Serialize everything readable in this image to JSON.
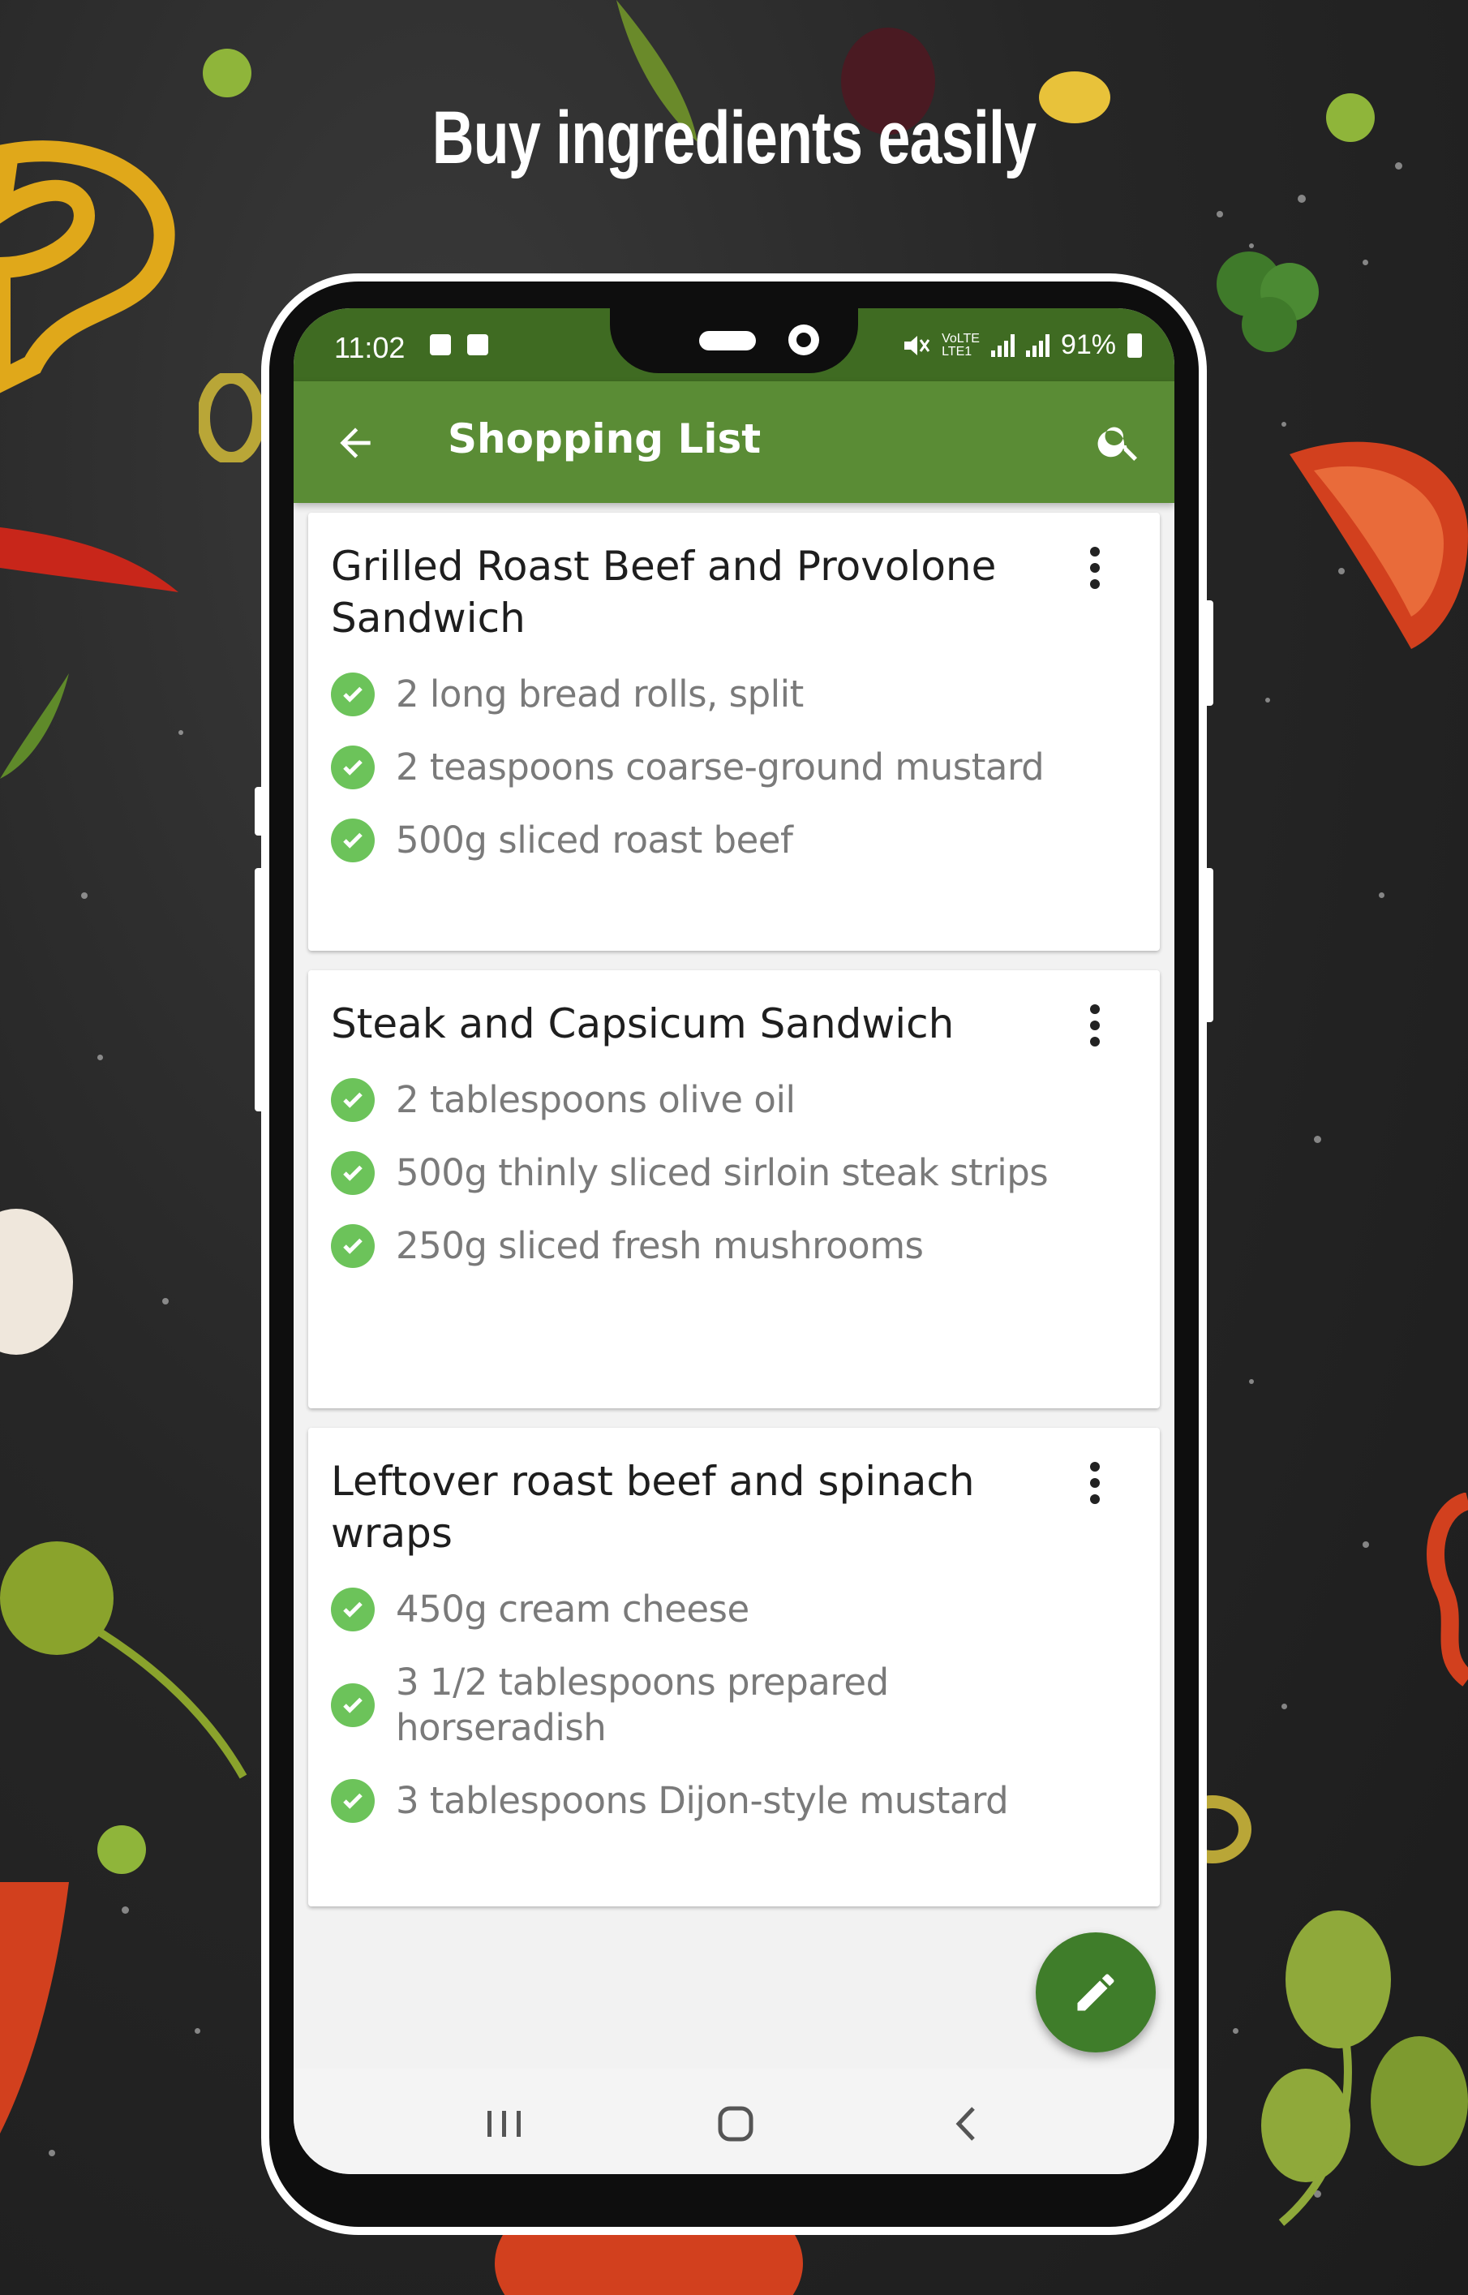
{
  "promo": {
    "headline": "Buy ingredients easily"
  },
  "status_bar": {
    "time": "11:02",
    "battery": "91%",
    "icons": [
      "check-notification-icon",
      "mail-notification-icon",
      "mute-icon",
      "volte-icon",
      "signal-icon",
      "battery-icon"
    ]
  },
  "app_bar": {
    "title": "Shopping List",
    "back_icon": "arrow-back-icon",
    "search_icon": "search-icon"
  },
  "recipes": [
    {
      "title": "Grilled Roast Beef and Provolone Sandwich",
      "ingredients": [
        "2 long bread rolls, split",
        "2 teaspoons coarse-ground mustard",
        "500g sliced roast beef"
      ]
    },
    {
      "title": "Steak and Capsicum Sandwich",
      "ingredients": [
        "2 tablespoons olive oil",
        "500g thinly sliced sirloin steak strips",
        "250g sliced fresh mushrooms"
      ]
    },
    {
      "title": "Leftover roast beef and spinach wraps",
      "ingredients": [
        "450g cream cheese",
        "3 1/2 tablespoons prepared horseradish",
        "3 tablespoons Dijon-style mustard"
      ]
    }
  ],
  "fab": {
    "icon": "pencil-edit-icon"
  },
  "nav_bar": {
    "icons": [
      "recents-icon",
      "home-icon",
      "back-icon"
    ]
  },
  "colors": {
    "status_bar": "#3f6b22",
    "app_bar": "#5a8c35",
    "fab": "#3f7d2a",
    "check": "#6cc35a",
    "background": "#262626"
  }
}
